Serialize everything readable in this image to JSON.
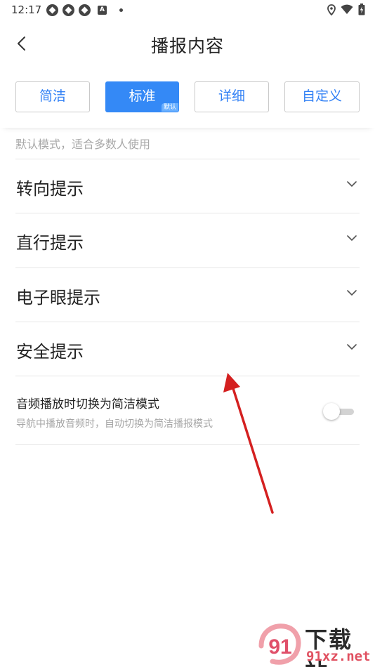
{
  "status_bar": {
    "time": "12:17",
    "notification_icons": [
      "app-notification-icon",
      "app-notification-icon",
      "app-notification-icon",
      "a-icon",
      "dot-icon"
    ],
    "right_icons": [
      "location-icon",
      "wifi-icon",
      "battery-charging-icon"
    ],
    "a_label": "A"
  },
  "header": {
    "title": "播报内容",
    "back_icon": "chevron-left-icon"
  },
  "mode_tabs": {
    "items": [
      {
        "label": "简洁",
        "selected": false
      },
      {
        "label": "标准",
        "selected": true
      },
      {
        "label": "详细",
        "selected": false
      },
      {
        "label": "自定义",
        "selected": false
      }
    ],
    "default_badge": "默认",
    "description": "默认模式，适合多数人使用"
  },
  "prompt_sections": [
    {
      "label": "转向提示",
      "icon": "chevron-down-icon"
    },
    {
      "label": "直行提示",
      "icon": "chevron-down-icon"
    },
    {
      "label": "电子眼提示",
      "icon": "chevron-down-icon"
    },
    {
      "label": "安全提示",
      "icon": "chevron-down-icon"
    }
  ],
  "audio_setting": {
    "title": "音频播放时切换为简洁模式",
    "subtitle": "导航中播放音频时，自动切换为简洁播报模式",
    "enabled": false
  },
  "watermark": {
    "title": "下载站",
    "url": "91xz.net",
    "logo_text": "91"
  },
  "colors": {
    "accent": "#3489f6",
    "annotation_arrow": "#d42020",
    "watermark_url": "#e05060"
  }
}
